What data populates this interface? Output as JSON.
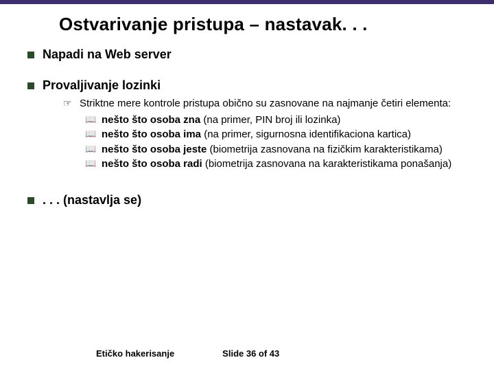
{
  "title": "Ostvarivanje pristupa – nastavak. . .",
  "sections": [
    {
      "text": "Napadi na Web server"
    },
    {
      "text": "Provaljivanje lozinki",
      "sub": {
        "text": "Striktne mere kontrole pristupa obično su zasnovane na najmanje četiri elementa:",
        "items": [
          {
            "bold": "nešto što osoba zna",
            "rest": " (na primer, PIN broj ili lozinka)"
          },
          {
            "bold": "nešto što osoba ima",
            "rest": " (na primer, sigurnosna identifikaciona kartica)"
          },
          {
            "bold": "nešto što osoba jeste",
            "rest": " (biometrija zasnovana na fizičkim karakteristikama)"
          },
          {
            "bold": " nešto što osoba radi",
            "rest": " (biometrija zasnovana na karakteristikama ponašanja)"
          }
        ]
      }
    },
    {
      "text": ". . . (nastavlja se)"
    }
  ],
  "footer": {
    "left": "Etičko hakerisanje",
    "right": "Slide 36 of 43"
  }
}
